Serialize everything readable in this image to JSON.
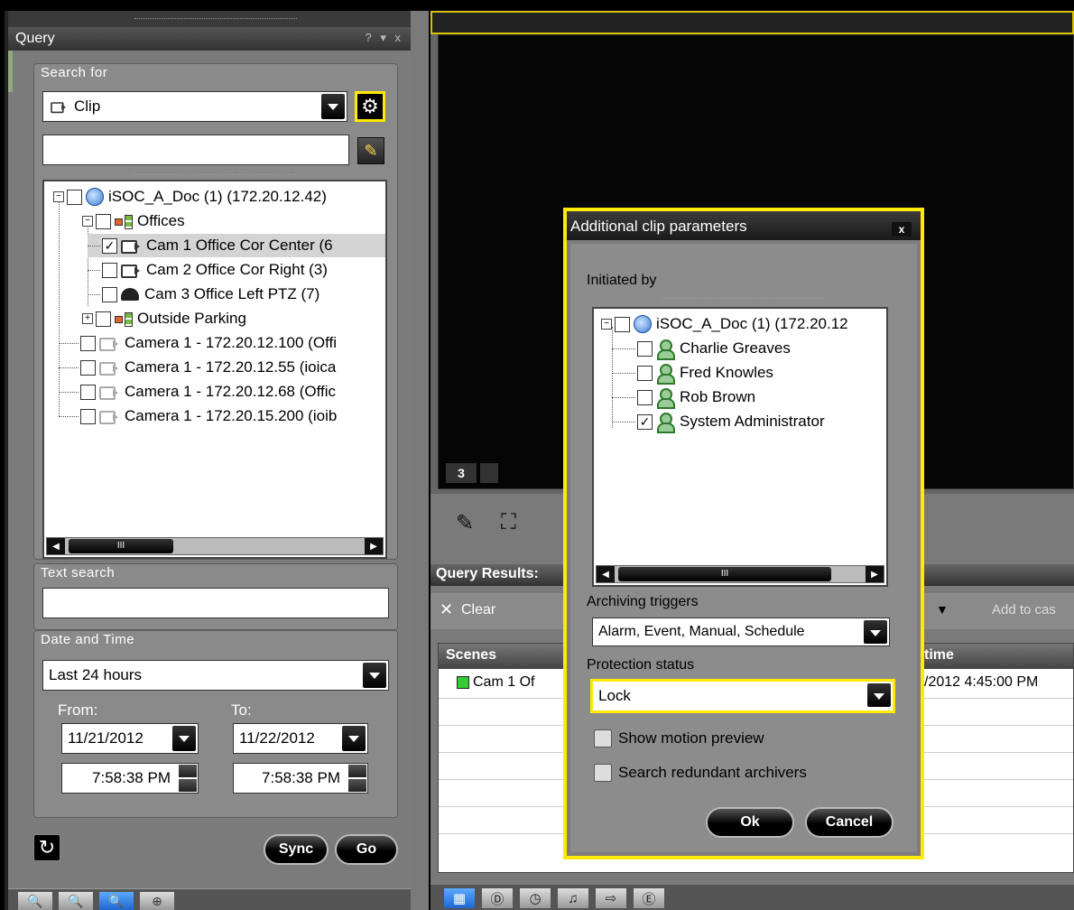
{
  "query_panel": {
    "title": "Query",
    "title_controls": "? ▾ x",
    "search_for_label": "Search for",
    "search_type_value": "Clip",
    "text_search_label": "Text search",
    "text_search_value": "",
    "date_time_label": "Date and Time",
    "date_range_value": "Last 24 hours",
    "from_label": "From:",
    "to_label": "To:",
    "from_date": "11/21/2012",
    "to_date": "11/22/2012",
    "from_time": "7:58:38 PM",
    "to_time": "7:58:38 PM",
    "sync_label": "Sync",
    "go_label": "Go",
    "tree": [
      {
        "label": "iSOC_A_Doc (1) (172.20.12.42)",
        "icon": "globe-icon",
        "checked": false
      },
      {
        "label": "Offices",
        "icon": "network-icon",
        "checked": false
      },
      {
        "label": "Cam 1 Office Cor Center (6",
        "icon": "camera-icon",
        "checked": true
      },
      {
        "label": "Cam 2 Office Cor Right (3)",
        "icon": "camera-icon",
        "checked": false
      },
      {
        "label": "Cam 3 Office Left PTZ (7)",
        "icon": "ptz-camera-icon",
        "checked": false
      },
      {
        "label": "Outside Parking",
        "icon": "network-icon",
        "checked": false
      },
      {
        "label": "Camera 1 - 172.20.12.100 (Offi",
        "icon": "camera-icon",
        "checked": false
      },
      {
        "label": "Camera 1 - 172.20.12.55 (ioica",
        "icon": "camera-icon",
        "checked": false
      },
      {
        "label": "Camera 1 - 172.20.12.68 (Offic",
        "icon": "camera-icon",
        "checked": false
      },
      {
        "label": "Camera 1 - 172.20.15.200 (ioib",
        "icon": "camera-icon",
        "checked": false
      }
    ],
    "scroll_thumb_label": "III"
  },
  "video": {
    "tile_number": "3"
  },
  "query_results": {
    "title": "Query Results:",
    "clear_label": "Clear",
    "add_to_case_label": "Add to cas",
    "col_scenes": "Scenes",
    "col_time": "time",
    "row1_scene": "Cam 1 Of",
    "row1_time": "/2012 4:45:00 PM"
  },
  "dialog": {
    "title": "Additional clip parameters",
    "close_label": "x",
    "initiated_by_label": "Initiated by",
    "users_tree": [
      {
        "label": "iSOC_A_Doc (1) (172.20.12",
        "checked": false
      },
      {
        "label": "Charlie Greaves",
        "checked": false
      },
      {
        "label": "Fred Knowles",
        "checked": false
      },
      {
        "label": "Rob Brown",
        "checked": false
      },
      {
        "label": "System Administrator",
        "checked": true
      }
    ],
    "scroll_thumb_label": "III",
    "archiving_triggers_label": "Archiving triggers",
    "archiving_triggers_value": "Alarm, Event, Manual, Schedule",
    "protection_status_label": "Protection status",
    "protection_status_value": "Lock",
    "show_motion_preview_label": "Show motion preview",
    "search_redundant_label": "Search redundant archivers",
    "ok_label": "Ok",
    "cancel_label": "Cancel"
  },
  "colors": {
    "highlight": "#ffea00",
    "panel": "#7b7b7b",
    "active_tab": "#1f66d1"
  }
}
